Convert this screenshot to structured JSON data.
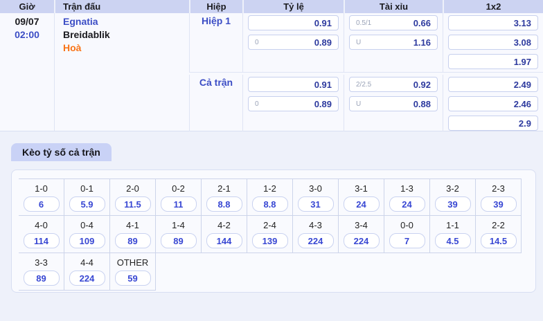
{
  "table": {
    "headers": {
      "time": "Giờ",
      "match": "Trận đấu",
      "period": "Hiệp",
      "handicap": "Tỷ lệ",
      "over_under": "Tài xỉu",
      "one_x_two": "1x2"
    },
    "match": {
      "date": "09/07",
      "time": "02:00",
      "home": "Egnatia",
      "away": "Breidablik",
      "draw": "Hoà"
    },
    "first_half": {
      "period": "Hiệp 1",
      "handicap": [
        {
          "line": "",
          "odds": "0.91"
        },
        {
          "line": "0",
          "odds": "0.89"
        }
      ],
      "over_under": [
        {
          "line": "0.5/1",
          "odds": "0.66"
        },
        {
          "line": "U",
          "odds": "1.16"
        }
      ],
      "one_x_two": [
        "3.13",
        "3.08",
        "1.97"
      ]
    },
    "full_time": {
      "period": "Cả trận",
      "handicap": [
        {
          "line": "",
          "odds": "0.91"
        },
        {
          "line": "0",
          "odds": "0.89"
        }
      ],
      "over_under": [
        {
          "line": "2/2.5",
          "odds": "0.92"
        },
        {
          "line": "U",
          "odds": "0.88"
        }
      ],
      "one_x_two": [
        "2.49",
        "2.46",
        "2.9"
      ]
    }
  },
  "correct_score": {
    "tab_label": "Kèo tỷ số cả trận",
    "row1": [
      {
        "score": "1-0",
        "odds": "6"
      },
      {
        "score": "0-1",
        "odds": "5.9"
      },
      {
        "score": "2-0",
        "odds": "11.5"
      },
      {
        "score": "0-2",
        "odds": "11"
      },
      {
        "score": "2-1",
        "odds": "8.8"
      },
      {
        "score": "1-2",
        "odds": "8.8"
      },
      {
        "score": "3-0",
        "odds": "31"
      },
      {
        "score": "3-1",
        "odds": "24"
      },
      {
        "score": "1-3",
        "odds": "24"
      },
      {
        "score": "3-2",
        "odds": "39"
      },
      {
        "score": "2-3",
        "odds": "39"
      }
    ],
    "row2": [
      {
        "score": "4-0",
        "odds": "114"
      },
      {
        "score": "0-4",
        "odds": "109"
      },
      {
        "score": "4-1",
        "odds": "89"
      },
      {
        "score": "1-4",
        "odds": "89"
      },
      {
        "score": "4-2",
        "odds": "144"
      },
      {
        "score": "2-4",
        "odds": "139"
      },
      {
        "score": "4-3",
        "odds": "224"
      },
      {
        "score": "3-4",
        "odds": "224"
      },
      {
        "score": "0-0",
        "odds": "7"
      },
      {
        "score": "1-1",
        "odds": "4.5"
      },
      {
        "score": "2-2",
        "odds": "14.5"
      }
    ],
    "row3": [
      {
        "score": "3-3",
        "odds": "89"
      },
      {
        "score": "4-4",
        "odds": "224"
      },
      {
        "score": "OTHER",
        "odds": "59"
      }
    ]
  },
  "colors": {
    "header_bg": "#ccd3f2",
    "accent_blue": "#3b4dc5",
    "odds_navy": "#2d3a9e",
    "grid_odds_blue": "#3847d3",
    "draw_orange": "#f97316",
    "tab_bg": "#c9d2f6"
  }
}
